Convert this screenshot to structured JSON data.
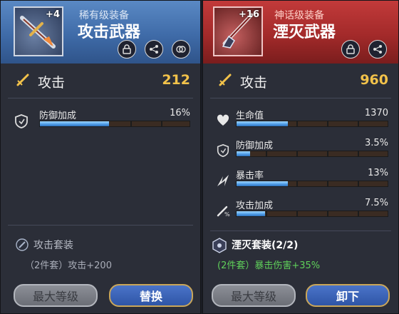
{
  "left_item": {
    "rarity": "稀有级装备",
    "name": "攻击武器",
    "enhance": "+4",
    "attack_label": "攻击",
    "attack_value": "212",
    "stats": [
      {
        "label": "防御加成",
        "value": "16%",
        "fill": 0.46
      }
    ],
    "set_title": "攻击套装",
    "set_desc": "（2件套）攻击+200",
    "btn_max_level": "最大等级",
    "btn_replace": "替换"
  },
  "right_item": {
    "rarity": "神话级装备",
    "name": "湮灭武器",
    "enhance": "+16",
    "attack_label": "攻击",
    "attack_value": "960",
    "stats": [
      {
        "label": "生命值",
        "value": "1370",
        "fill": 0.34
      },
      {
        "label": "防御加成",
        "value": "3.5%",
        "fill": 0.09
      },
      {
        "label": "暴击率",
        "value": "13%",
        "fill": 0.34
      },
      {
        "label": "攻击加成",
        "value": "7.5%",
        "fill": 0.19
      }
    ],
    "set_title": "湮灭套装(2/2)",
    "set_desc": "(2件套）暴击伤害+35%",
    "btn_max_level": "最大等级",
    "btn_unequip": "卸下"
  },
  "colors": {
    "attack_value": "#f2c24a",
    "set_active": "#5fd05a",
    "set_inactive": "#a9adb8",
    "rare_header": "#4a7ab8",
    "mythic_header": "#b03030"
  },
  "icons": [
    "sword-icon",
    "lock-icon",
    "share-icon",
    "compare-icon",
    "shield-icon",
    "heart-icon",
    "crit-icon",
    "attack-boost-icon",
    "set-icon"
  ]
}
